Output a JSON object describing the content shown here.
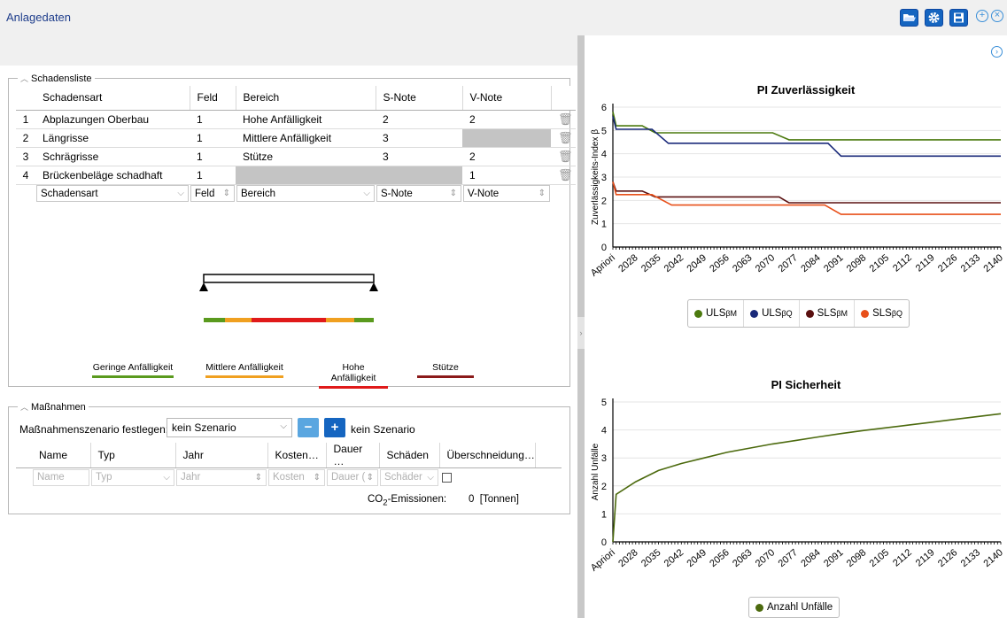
{
  "app_title": "Anlagedaten",
  "toolbar": {
    "open_icon": "folder-open-icon",
    "settings_icon": "gear-icon",
    "save_icon": "save-icon",
    "add_icon": "plus-circle-icon",
    "close_icon": "close-circle-icon",
    "next_icon": "chevron-right-circle-icon"
  },
  "schadensliste": {
    "legend": "Schadensliste",
    "columns": [
      "Schadensart",
      "Feld",
      "Bereich",
      "S-Note",
      "V-Note"
    ],
    "rows": [
      {
        "nr": "1",
        "schadensart": "Abplazungen Oberbau",
        "feld": "1",
        "bereich": "Hohe Anfälligkeit",
        "s_note": "2",
        "v_note": "2"
      },
      {
        "nr": "2",
        "schadensart": "Längrisse",
        "feld": "1",
        "bereich": "Mittlere Anfälligkeit",
        "s_note": "3",
        "v_note": ""
      },
      {
        "nr": "3",
        "schadensart": "Schrägrisse",
        "feld": "1",
        "bereich": "Stütze",
        "s_note": "3",
        "v_note": "2"
      },
      {
        "nr": "4",
        "schadensart": "Brückenbeläge schadhaft",
        "feld": "1",
        "bereich": "",
        "s_note": "",
        "v_note": "1"
      }
    ],
    "new_row_placeholders": [
      "Schadensart",
      "Feld",
      "Bereich",
      "S-Note",
      "V-Note"
    ]
  },
  "anfaelligkeit_legend": [
    {
      "label": "Geringe Anfälligkeit",
      "color": "#5a9a1e"
    },
    {
      "label": "Mittlere Anfälligkeit",
      "color": "#f0a020"
    },
    {
      "label": "Hohe Anfälligkeit",
      "color": "#e01a1a"
    },
    {
      "label": "Stütze",
      "color": "#8b1a1a"
    }
  ],
  "massnahmen": {
    "legend": "Maßnahmen",
    "scenario_label": "Maßnahmenszenario festlegen:",
    "scenario_value": "kein Szenario",
    "scenario_text": "kein Szenario",
    "columns": [
      "Name",
      "Typ",
      "Jahr",
      "Kosten…",
      "Dauer …",
      "Schäden",
      "Überschneidung…"
    ],
    "new_row_placeholders": [
      "Name",
      "Typ",
      "Jahr",
      "Kosten",
      "Dauer (",
      "Schäder"
    ],
    "co2_label": "CO",
    "co2_sub": "2",
    "co2_label_rest": "-Emissionen:",
    "co2_value": "0",
    "co2_unit": "[Tonnen]"
  },
  "chart_data": [
    {
      "type": "line",
      "title": "PI Zuverlässigkeit",
      "ylabel": "Zuverlässigkeits-Index β",
      "ylim": [
        0,
        6
      ],
      "yticks": [
        "0",
        "1",
        "2",
        "3",
        "4",
        "5",
        "6"
      ],
      "xticks": [
        "Apriori",
        "2028",
        "2035",
        "2042",
        "2049",
        "2056",
        "2063",
        "2070",
        "2077",
        "2084",
        "2091",
        "2098",
        "2105",
        "2112",
        "2119",
        "2126",
        "2133",
        "2140"
      ],
      "series": [
        {
          "name": "ULS",
          "sub": "βM",
          "color": "#4c7a0e",
          "points": [
            [
              2021,
              5.8
            ],
            [
              2022,
              5.2
            ],
            [
              2030,
              5.2
            ],
            [
              2034,
              4.9
            ],
            [
              2070,
              4.9
            ],
            [
              2075,
              4.6
            ],
            [
              2140,
              4.6
            ]
          ]
        },
        {
          "name": "ULS",
          "sub": "βQ",
          "color": "#1a2a7a",
          "points": [
            [
              2021,
              5.6
            ],
            [
              2022,
              5.05
            ],
            [
              2033,
              5.05
            ],
            [
              2038,
              4.45
            ],
            [
              2087,
              4.45
            ],
            [
              2091,
              3.9
            ],
            [
              2140,
              3.9
            ]
          ]
        },
        {
          "name": "SLS",
          "sub": "βM",
          "color": "#5a1010",
          "points": [
            [
              2021,
              2.8
            ],
            [
              2022,
              2.4
            ],
            [
              2030,
              2.4
            ],
            [
              2034,
              2.15
            ],
            [
              2072,
              2.15
            ],
            [
              2075,
              1.9
            ],
            [
              2140,
              1.9
            ]
          ]
        },
        {
          "name": "SLS",
          "sub": "βQ",
          "color": "#e8501a",
          "points": [
            [
              2021,
              2.8
            ],
            [
              2022,
              2.25
            ],
            [
              2033,
              2.25
            ],
            [
              2039,
              1.8
            ],
            [
              2086,
              1.8
            ],
            [
              2091,
              1.4
            ],
            [
              2140,
              1.4
            ]
          ]
        }
      ]
    },
    {
      "type": "line",
      "title": "PI Sicherheit",
      "ylabel": "Anzahl Unfälle",
      "ylim": [
        0,
        5
      ],
      "yticks": [
        "0",
        "1",
        "2",
        "3",
        "4",
        "5"
      ],
      "xticks": [
        "Apriori",
        "2028",
        "2035",
        "2042",
        "2049",
        "2056",
        "2063",
        "2070",
        "2077",
        "2084",
        "2091",
        "2098",
        "2105",
        "2112",
        "2119",
        "2126",
        "2133",
        "2140"
      ],
      "series": [
        {
          "name": "Anzahl Unfälle",
          "color": "#4c6a0e",
          "points": [
            [
              2021,
              0
            ],
            [
              2022,
              1.7
            ],
            [
              2028,
              2.15
            ],
            [
              2035,
              2.55
            ],
            [
              2042,
              2.8
            ],
            [
              2049,
              3.0
            ],
            [
              2056,
              3.2
            ],
            [
              2063,
              3.35
            ],
            [
              2070,
              3.5
            ],
            [
              2077,
              3.62
            ],
            [
              2084,
              3.75
            ],
            [
              2091,
              3.87
            ],
            [
              2098,
              3.98
            ],
            [
              2105,
              4.08
            ],
            [
              2112,
              4.18
            ],
            [
              2119,
              4.28
            ],
            [
              2126,
              4.38
            ],
            [
              2133,
              4.48
            ],
            [
              2140,
              4.58
            ]
          ]
        }
      ]
    }
  ]
}
